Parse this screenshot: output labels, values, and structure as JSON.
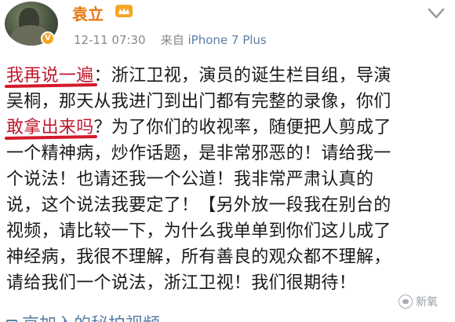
{
  "user": {
    "name": "袁立",
    "verified_badge": "V",
    "vip_icon": "vip-crown-icon"
  },
  "meta": {
    "time": "12-11 07:30",
    "source_prefix": "来自",
    "source": "iPhone 7 Plus"
  },
  "post": {
    "lines": [
      {
        "hl": "我再说一遍",
        "rest": "：浙江卫视，演员的诞生栏目组，导演"
      },
      {
        "hl": "",
        "rest": "吴桐，那天从我进门到出门都有完整的录像，你们"
      },
      {
        "hl": "敢拿出来吗",
        "rest": "？为了你们的收视率，随便把人剪成了"
      },
      {
        "hl": "",
        "rest": "一个精神病，炒作话题，是非常邪恶的！请给我一"
      },
      {
        "hl": "",
        "rest": "个说法！也请还我一个公道！我非常严肃认真的"
      },
      {
        "hl": "",
        "rest": "说，这个说法我要定了！【另外放一段我在别台的"
      },
      {
        "hl": "",
        "rest": "视频，请比较一下，为什么我单单到你们这儿成了"
      },
      {
        "hl": "",
        "rest": "神经病，我很不理解，所有善良的观众都不理解，"
      },
      {
        "hl": "",
        "rest": "请给我们一个说法，浙江卫视！我们很期待！"
      }
    ],
    "cut_line": "京加入的秘拍视频"
  },
  "watermark": {
    "text": "新氧"
  },
  "colors": {
    "username": "#e8780f",
    "highlight": "#c0182b",
    "meta": "#888888",
    "link": "#5b7fa6"
  }
}
